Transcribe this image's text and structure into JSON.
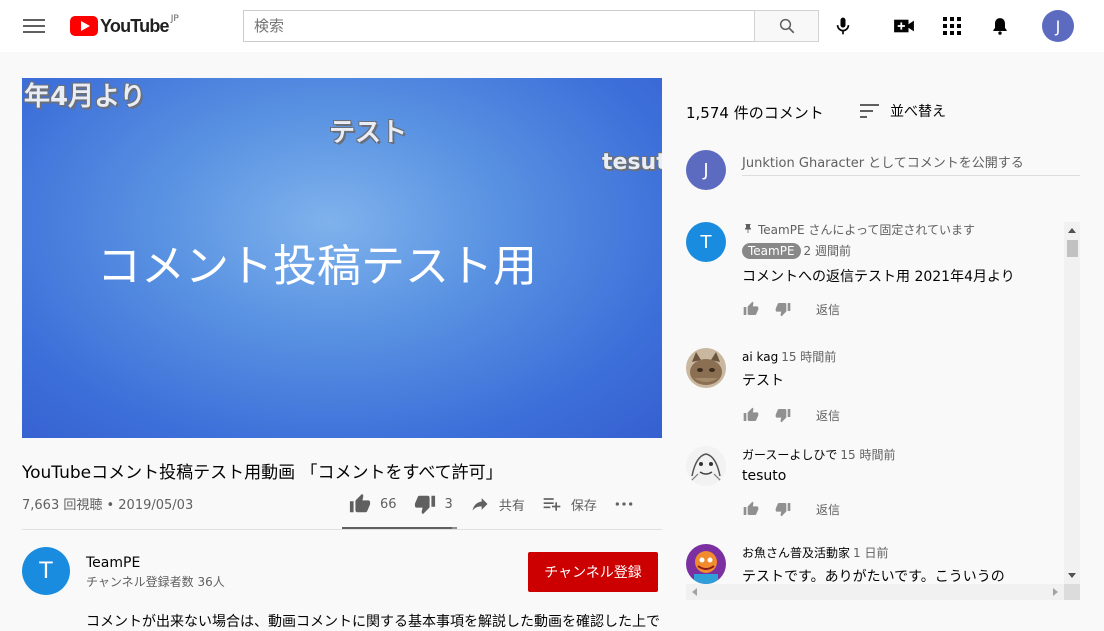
{
  "header": {
    "logo_text": "YouTube",
    "logo_region": "JP",
    "search_placeholder": "検索",
    "avatar_initial": "J",
    "icons": [
      "menu-icon",
      "search-icon",
      "mic-icon",
      "create-video-icon",
      "apps-icon",
      "bell-icon"
    ]
  },
  "video": {
    "overlay_texts": [
      "年4月より",
      "テスト",
      "tesuto"
    ],
    "main_text": "コメント投稿テスト用",
    "title": "YouTubeコメント投稿テスト用動画 「コメントをすべて許可」",
    "meta": "7,663 回視聴 • 2019/05/03",
    "likes": "66",
    "dislikes": "3",
    "like_ratio": 0.96,
    "share_label": "共有",
    "save_label": "保存"
  },
  "channel": {
    "avatar_initial": "T",
    "name": "TeamPE",
    "subscribers": "チャンネル登録者数 36人",
    "subscribe_label": "チャンネル登録",
    "description": "コメントが出来ない場合は、動画コメントに関する基本事項を解説した動画を確認した上で"
  },
  "comments": {
    "count_label": "1,574 件のコメント",
    "sort_label": "並べ替え",
    "current_user_initial": "J",
    "add_placeholder": "Junktion Gharacter としてコメントを公開する",
    "reply_label": "返信",
    "items": [
      {
        "pinned_label": "TeamPE さんによって固定されています",
        "author": "TeamPE",
        "is_owner": true,
        "time": "2 週間前",
        "text": "コメントへの返信テスト用 2021年4月より",
        "avatar_initial": "T",
        "avatar_color": "#1a8ce0"
      },
      {
        "author": "ai kag",
        "time": "15 時間前",
        "text": "テスト",
        "avatar_kind": "cat"
      },
      {
        "author": "ガースーよしひで",
        "time": "15 時間前",
        "text": "tesuto",
        "avatar_kind": "sketch"
      },
      {
        "author": "お魚さん普及活動家",
        "time": "1 日前",
        "text": "テストです。ありがたいです。こういうの",
        "avatar_kind": "colorful"
      }
    ]
  },
  "colors": {
    "subscribe_red": "#cc0000",
    "accent_blue": "#1a8ce0",
    "user_avatar": "#5c6bc0"
  }
}
